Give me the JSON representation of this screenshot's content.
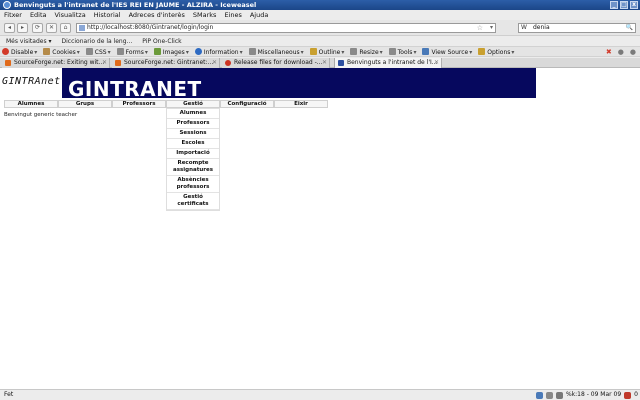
{
  "window": {
    "title": "Benvinguts a l'intranet de l'IES REI EN JAUME - ALZIRA - Iceweasel"
  },
  "menubar": [
    "Fitxer",
    "Edita",
    "Visualitza",
    "Historial",
    "Adreces d'interès",
    "SMarks",
    "Eines",
    "Ajuda"
  ],
  "navbar": {
    "url": "http://localhost:8080/Gintranet/login/login",
    "search_value": "denia",
    "search_engine": "W",
    "back_glyph": "◂",
    "forward_glyph": "▸",
    "reload_glyph": "⟳",
    "stop_glyph": "✕",
    "home_glyph": "⌂",
    "star_glyph": "☆",
    "drop_glyph": "▾",
    "search_glyph": "🔍"
  },
  "bookmarks": [
    "Més visitades ▾",
    "Diccionario de la leng...",
    "PiP One-Click"
  ],
  "devbar": {
    "items": [
      {
        "label": "Disable",
        "icon": "no-entry-icon",
        "color": "#d23a2a"
      },
      {
        "label": "Cookies",
        "icon": "cookie-icon",
        "color": "#b58b4a"
      },
      {
        "label": "CSS",
        "icon": "css-icon",
        "color": "#8a8a8a"
      },
      {
        "label": "Forms",
        "icon": "forms-icon",
        "color": "#8a8a8a"
      },
      {
        "label": "Images",
        "icon": "images-icon",
        "color": "#6b9a3a"
      },
      {
        "label": "Information",
        "icon": "info-icon",
        "color": "#2d6ac2"
      },
      {
        "label": "Miscellaneous",
        "icon": "misc-icon",
        "color": "#8a8a8a"
      },
      {
        "label": "Outline",
        "icon": "outline-icon",
        "color": "#c9a030"
      },
      {
        "label": "Resize",
        "icon": "resize-icon",
        "color": "#8a8a8a"
      },
      {
        "label": "Tools",
        "icon": "tools-icon",
        "color": "#8a8a8a"
      },
      {
        "label": "View Source",
        "icon": "view-source-icon",
        "color": "#4a7ab8"
      },
      {
        "label": "Options",
        "icon": "options-icon",
        "color": "#c9a030"
      }
    ],
    "caret": "▾",
    "close_glyph": "✖",
    "ok_glyph": "●",
    "gear_glyph": "●"
  },
  "tabs": [
    {
      "label": "SourceForge.net: Exiting wit...",
      "fav_color": "#e06a1a",
      "active": false
    },
    {
      "label": "SourceForge.net: Gintranet:...",
      "fav_color": "#e06a1a",
      "active": false
    },
    {
      "label": "Release files for download -...",
      "fav_color": "#cc3322",
      "active": false
    },
    {
      "label": "Benvinguts a l'intranet de l'I...",
      "fav_color": "#2d4fa0",
      "active": true
    }
  ],
  "tab_close": "✕",
  "page": {
    "logo_text": "GINTRAnet",
    "banner_title": "GINTRANET",
    "main_menu": [
      "Alumnes",
      "Grups",
      "Professors",
      "Gestió",
      "Configuració",
      "Eixir"
    ],
    "submenu": [
      "Alumnes",
      "Professors",
      "Sessions",
      "Escoles",
      "Importació",
      "Recompte assignatures",
      "Absències professors",
      "Gestió certificats"
    ],
    "greeting": "Benvingut generic teacher"
  },
  "status": {
    "text": "Fet",
    "clock": "%k:18 - 09 Mar 09",
    "mail_count": "0"
  },
  "colors": {
    "banner_navy": "#06085e",
    "titlebar": "#2c5ea8"
  }
}
